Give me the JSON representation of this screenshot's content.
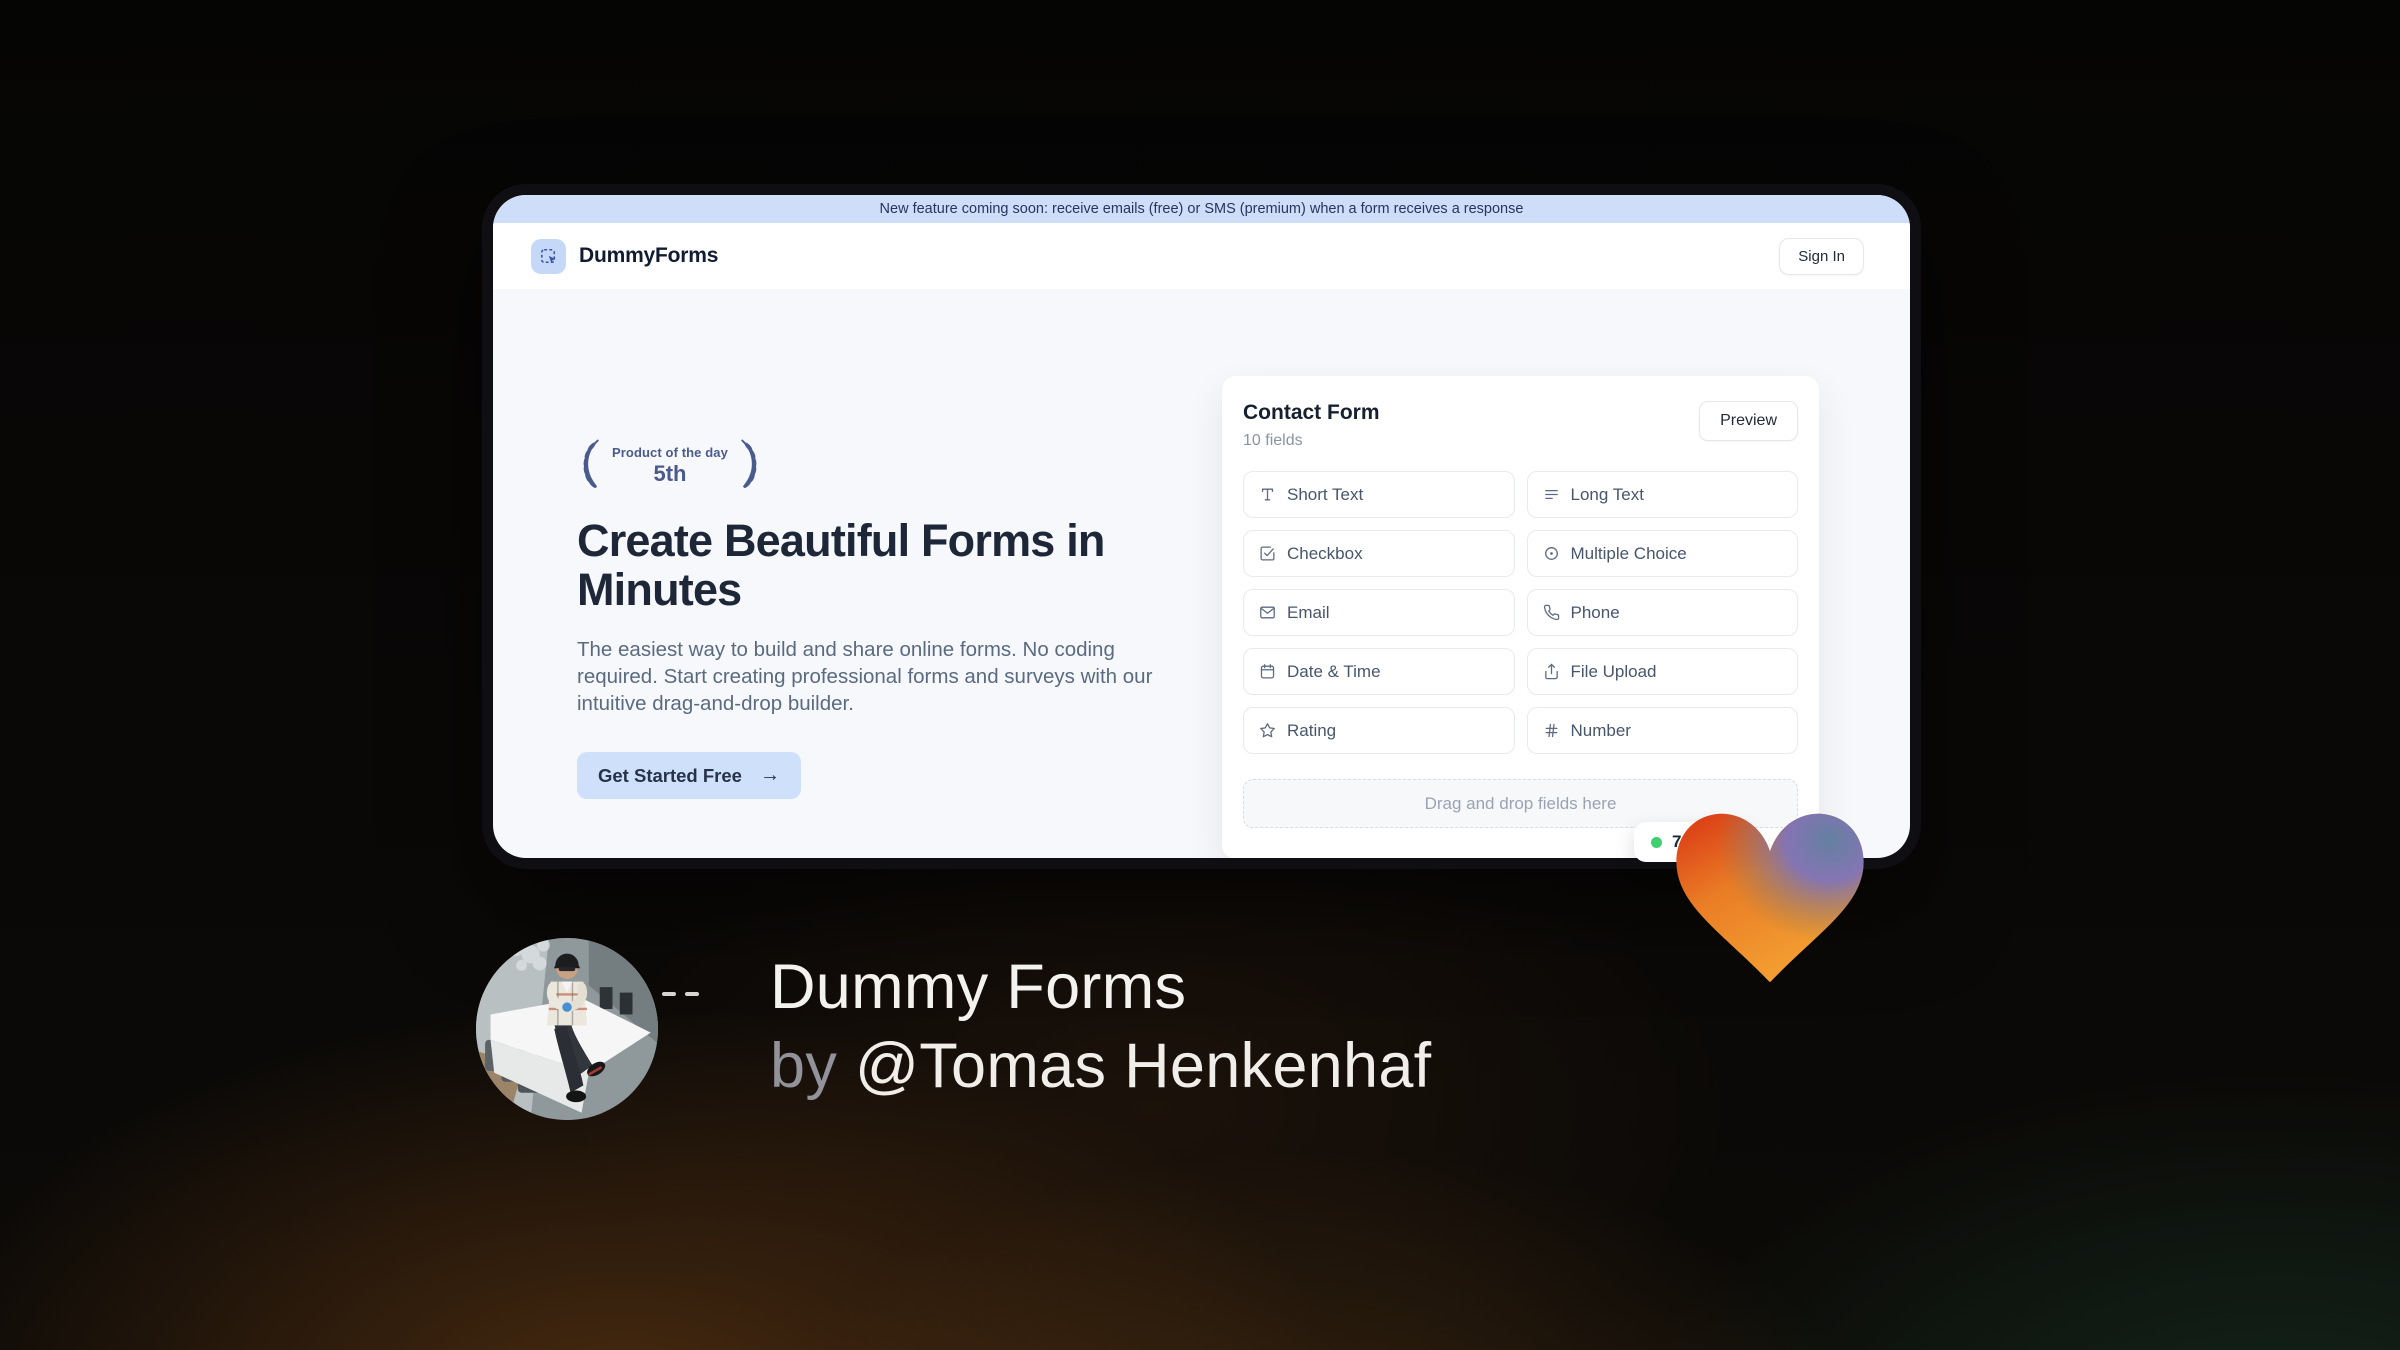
{
  "banner": {
    "text": "New feature coming soon: receive emails (free) or SMS (premium) when a form receives a response"
  },
  "header": {
    "brand": "DummyForms",
    "logo_icon": "cursor-select-icon",
    "sign_in_label": "Sign In"
  },
  "hero": {
    "award_line1": "Product of the day",
    "award_line2": "5th",
    "title": "Create Beautiful Forms in Minutes",
    "description": "The easiest way to build and share online forms. No coding required. Start creating professional forms and surveys with our intuitive drag-and-drop builder.",
    "cta_label": "Get Started Free",
    "cta_arrow": "→"
  },
  "form_builder": {
    "title": "Contact Form",
    "field_count": "10 fields",
    "preview_label": "Preview",
    "fields": [
      {
        "label": "Short Text",
        "icon": "short-text-icon"
      },
      {
        "label": "Long Text",
        "icon": "long-text-icon"
      },
      {
        "label": "Checkbox",
        "icon": "checkbox-icon"
      },
      {
        "label": "Multiple Choice",
        "icon": "radio-icon"
      },
      {
        "label": "Email",
        "icon": "email-icon"
      },
      {
        "label": "Phone",
        "icon": "phone-icon"
      },
      {
        "label": "Date & Time",
        "icon": "calendar-icon"
      },
      {
        "label": "File Upload",
        "icon": "upload-icon"
      },
      {
        "label": "Rating",
        "icon": "star-icon"
      },
      {
        "label": "Number",
        "icon": "hash-icon"
      }
    ],
    "dropzone_text": "Drag and drop fields here",
    "live_badge_value": "7"
  },
  "caption": {
    "title": "Dummy Forms",
    "byline_prefix": "by",
    "byline_name": "@Tomas Henkenhaf"
  },
  "colors": {
    "banner_bg": "#cfdef8",
    "brand_navy": "#121c30",
    "accent_blue": "#cfe0fa",
    "laurel_blue": "#4a5a8c",
    "field_text": "#47566b",
    "live_dot_green": "#3fcf6f",
    "heart_red": "#d93414",
    "heart_orange": "#f4a233",
    "heart_blue": "#7b74c0"
  }
}
